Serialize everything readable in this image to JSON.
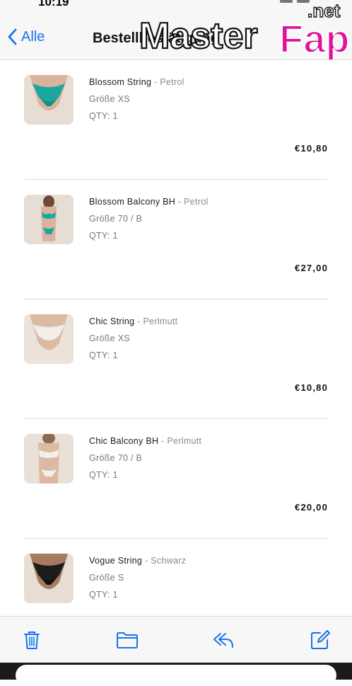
{
  "status_bar": {
    "time": "10:19"
  },
  "nav": {
    "back_label": "Alle",
    "title": "Bestellbestätigung"
  },
  "watermark": {
    "text": "MasterFap",
    "suffix": ".net"
  },
  "items": [
    {
      "name": "Blossom String",
      "variant": "Petrol",
      "size": "Größe XS",
      "qty": "QTY: 1",
      "price": "€10,80"
    },
    {
      "name": "Blossom Balcony BH",
      "variant": "Petrol",
      "size": "Größe 70 / B",
      "qty": "QTY: 1",
      "price": "€27,00"
    },
    {
      "name": "Chic String",
      "variant": "Perlmutt",
      "size": "Größe XS",
      "qty": "QTY: 1",
      "price": "€10,80"
    },
    {
      "name": "Chic Balcony BH",
      "variant": "Perlmutt",
      "size": "Größe 70 / B",
      "qty": "QTY: 1",
      "price": "€20,00"
    },
    {
      "name": "Vogue String",
      "variant": "Schwarz",
      "size": "Größe S",
      "qty": "QTY: 1",
      "price": ""
    }
  ],
  "toolbar": {
    "icons": [
      "trash-icon",
      "folder-icon",
      "reply-icon",
      "compose-icon"
    ]
  },
  "colors": {
    "accent": "#1a73e8",
    "petrol": "#1aa7a0",
    "pearl": "#f1e9e2",
    "black": "#1c1c1c"
  }
}
